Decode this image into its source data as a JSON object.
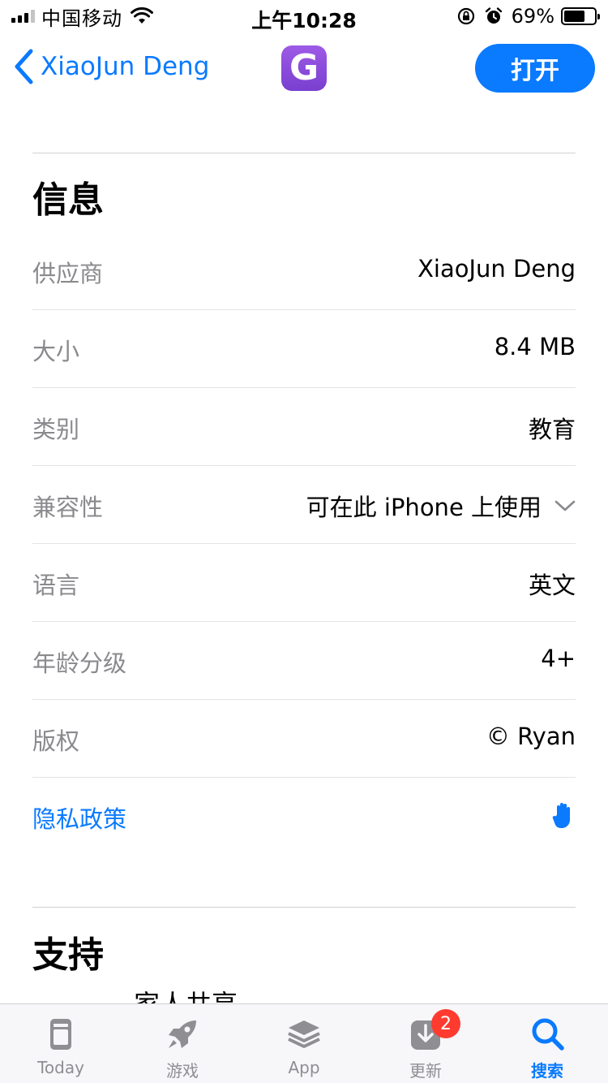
{
  "status_bar": {
    "carrier": "中国移动",
    "time": "上午10:28",
    "battery_percent": "69%",
    "battery_level": 0.69,
    "icons": [
      "signal-icon",
      "wifi-icon",
      "orientation-lock-icon",
      "alarm-icon",
      "battery-icon"
    ]
  },
  "nav": {
    "back_label": "XiaoJun Deng",
    "app_icon_letter": "G",
    "open_label": "打开",
    "accent_color": "#0a7aff"
  },
  "info": {
    "title": "信息",
    "rows": [
      {
        "label": "供应商",
        "value": "XiaoJun Deng"
      },
      {
        "label": "大小",
        "value": "8.4 MB"
      },
      {
        "label": "类别",
        "value": "教育"
      },
      {
        "label": "兼容性",
        "value": "可在此 iPhone 上使用"
      },
      {
        "label": "语言",
        "value": "英文"
      },
      {
        "label": "年龄分级",
        "value": "4+"
      },
      {
        "label": "版权",
        "value": "© Ryan"
      },
      {
        "label": "隐私政策",
        "value": ""
      }
    ]
  },
  "support": {
    "title": "支持",
    "first_item_partial": "家人共享"
  },
  "tabbar": {
    "tabs": [
      {
        "label": "Today",
        "icon": "today-icon"
      },
      {
        "label": "游戏",
        "icon": "rocket-icon"
      },
      {
        "label": "App",
        "icon": "layers-icon"
      },
      {
        "label": "更新",
        "icon": "download-icon",
        "badge": "2"
      },
      {
        "label": "搜索",
        "icon": "search-icon",
        "active": true
      }
    ]
  }
}
